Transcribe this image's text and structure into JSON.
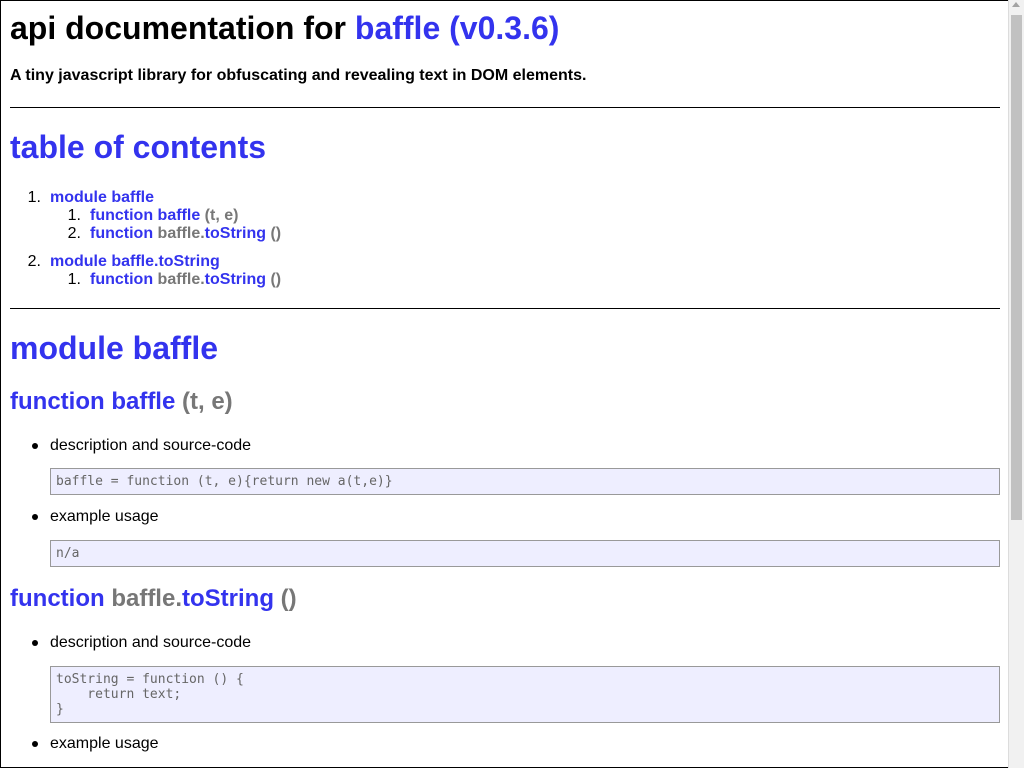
{
  "header": {
    "title_prefix": "api documentation for ",
    "title_link": "baffle (v0.3.6)",
    "tagline": "A tiny javascript library for obfuscating and revealing text in DOM elements."
  },
  "toc": {
    "heading": "table of contents",
    "modules": [
      {
        "number": "1.",
        "label": "module baffle",
        "functions": [
          {
            "number": "1.",
            "keyword": "function",
            "prefix": "",
            "name": "baffle",
            "args": "(t, e)"
          },
          {
            "number": "2.",
            "keyword": "function",
            "prefix": "baffle.",
            "name": "toString",
            "args": "()"
          }
        ]
      },
      {
        "number": "2.",
        "label": "module baffle.toString",
        "functions": [
          {
            "number": "1.",
            "keyword": "function",
            "prefix": "baffle.",
            "name": "toString",
            "args": "()"
          }
        ]
      }
    ]
  },
  "module_baffle": {
    "heading": "module baffle",
    "functions": [
      {
        "keyword": "function",
        "prefix": "",
        "name": "baffle",
        "args": "(t, e)",
        "desc_label": "description and source-code",
        "source": "baffle = function (t, e){return new a(t,e)}",
        "example_label": "example usage",
        "example": "n/a"
      },
      {
        "keyword": "function",
        "prefix": "baffle.",
        "name": "toString",
        "args": "()",
        "desc_label": "description and source-code",
        "source": "toString = function () {\n    return text;\n}",
        "example_label": "example usage"
      }
    ]
  },
  "colors": {
    "link": "#3333ee",
    "muted": "#777777",
    "code_bg": "#eeeeff",
    "code_border": "#999999"
  }
}
